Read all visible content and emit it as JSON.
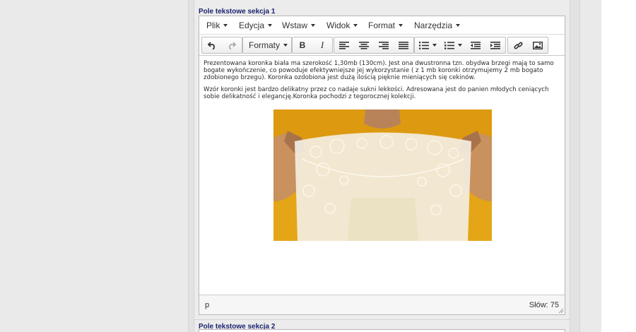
{
  "sections": {
    "first_label": "Pole tekstowe sekcja 1",
    "second_label": "Pole tekstowe sekcja 2"
  },
  "menubar": {
    "items": [
      "Plik",
      "Edycja",
      "Wstaw",
      "Widok",
      "Format",
      "Narzędzia"
    ]
  },
  "toolbar": {
    "formats_label": "Formaty",
    "bold_label": "B",
    "italic_label": "I",
    "icons": [
      "undo-icon",
      "redo-icon",
      "bold-icon",
      "italic-icon",
      "align-left-icon",
      "align-center-icon",
      "align-right-icon",
      "align-justify-icon",
      "bullet-list-icon",
      "numbered-list-icon",
      "outdent-icon",
      "indent-icon",
      "link-icon",
      "image-icon"
    ]
  },
  "content": {
    "paragraph1": "Prezentowana koronka biała ma szerokość 1,30mb (130cm). Jest ona dwustronna tzn. obydwa brzegi mają to samo bogate wykończenie, co powoduje efektywniejsze jej wykorzystanie ( z 1 mb koronki otrzymujemy 2 mb bogato zdobionego brzegu). Koronka ozdobiona jest dużą ilością pięknie mieniących się cekinów.",
    "paragraph2": "Wzór koronki jest bardzo delikatny przez co nadaje sukni lekkości. Adresowana jest do panien młodych ceniących sobie delikatność i elegancję.Koronka pochodzi z tegorocznej kolekcji."
  },
  "status": {
    "path": "p",
    "word_count": "Słów: 75"
  },
  "colors": {
    "label_navy": "#1c2470",
    "photo_background": "#e6a61a"
  }
}
